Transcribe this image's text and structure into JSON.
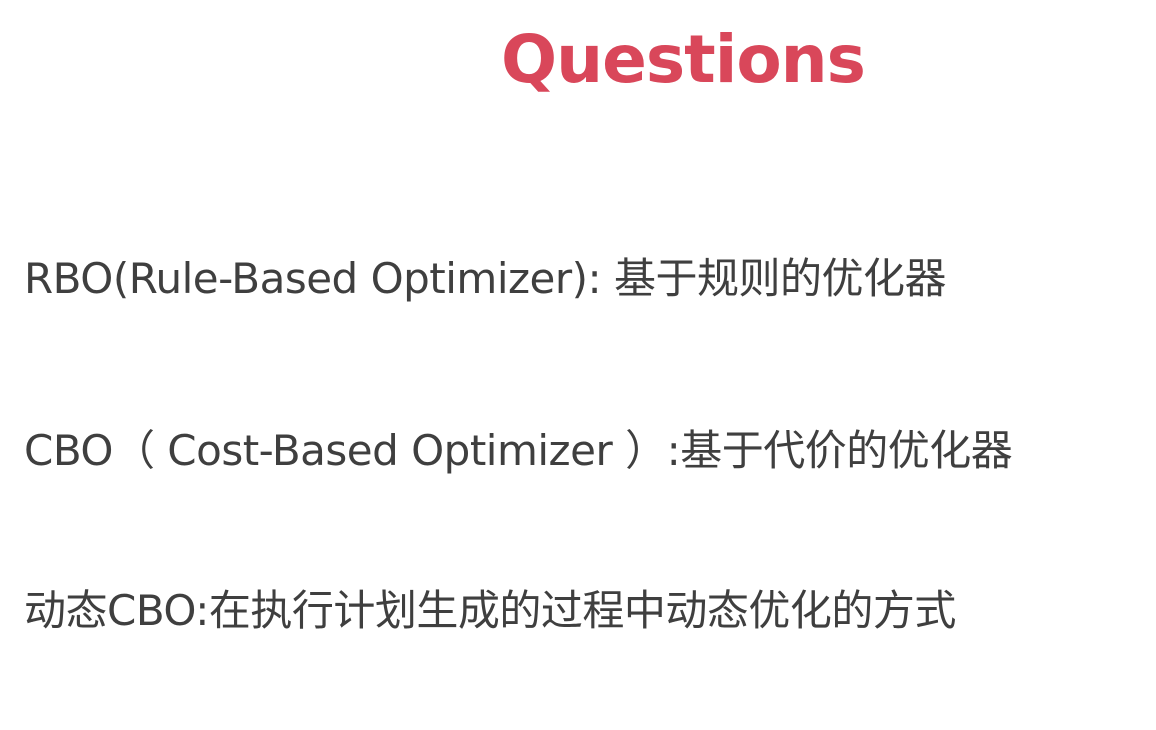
{
  "slide": {
    "title": "Questions",
    "bullets": [
      "RBO(Rule-Based Optimizer): 基于规则的优化器",
      "CBO（ Cost-Based Optimizer ）:基于代价的优化器",
      "动态CBO:在执行计划生成的过程中动态优化的方式"
    ]
  },
  "colors": {
    "title": "#d9475a",
    "text": "#3f3f3f",
    "background": "#ffffff"
  }
}
